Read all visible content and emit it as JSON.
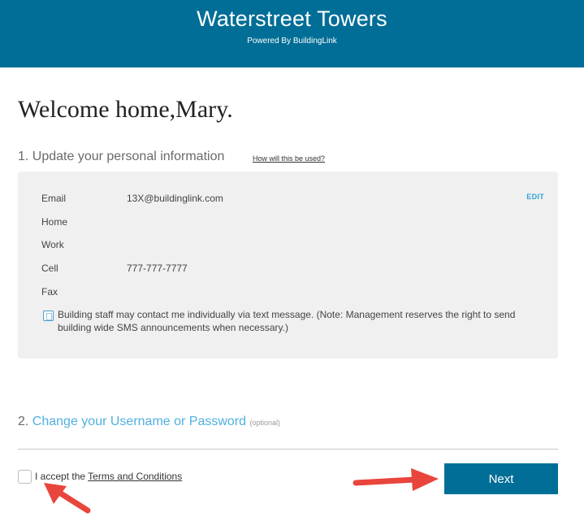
{
  "header": {
    "title": "Waterstreet Towers",
    "subtitle": "Powered By BuildingLink"
  },
  "welcome": "Welcome home,Mary.",
  "step1": {
    "title": "1. Update your personal information",
    "help_link": "How will this be used?"
  },
  "info": {
    "edit_label": "EDIT",
    "rows": [
      {
        "label": "Email",
        "value": "13X@buildinglink.com"
      },
      {
        "label": "Home",
        "value": ""
      },
      {
        "label": "Work",
        "value": ""
      },
      {
        "label": "Cell",
        "value": "777-777-7777"
      },
      {
        "label": "Fax",
        "value": ""
      }
    ],
    "sms_text": "Building staff may contact me individually via text message. (Note: Management reserves the right to send building wide SMS announcements when necessary.)"
  },
  "step2": {
    "number": "2.",
    "link": "Change your Username or Password",
    "optional": "(optional)"
  },
  "terms": {
    "prefix": "I accept the",
    "link": "Terms and Conditions"
  },
  "next_label": "Next",
  "colors": {
    "header_bg": "#006e96",
    "accent_link": "#4fb0e0",
    "annotation_arrow": "#e8453c"
  }
}
